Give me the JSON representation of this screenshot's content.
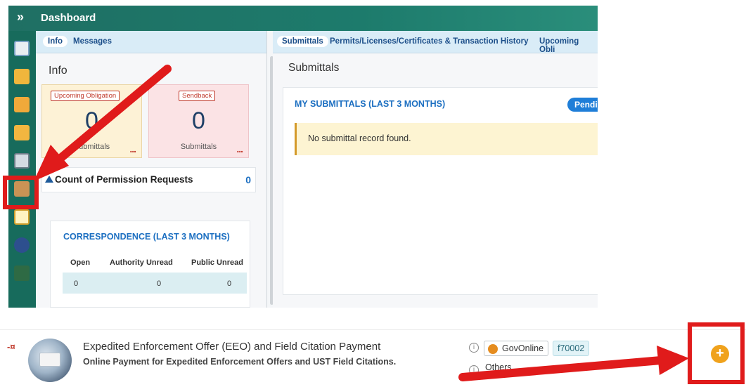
{
  "topbar": {
    "expand_glyph": "»",
    "title": "Dashboard"
  },
  "left_rail": {
    "icons": [
      "dashboard-icon",
      "folder-icon",
      "folder-icon",
      "folder-icon",
      "book-icon",
      "handshake-icon",
      "document-icon",
      "globe-icon",
      "building-icon"
    ]
  },
  "info_panel": {
    "tabs": [
      {
        "label": "Info",
        "active": true
      },
      {
        "label": "Messages",
        "active": false
      }
    ],
    "title": "Info",
    "upcoming": {
      "badge": "Upcoming Obligation",
      "count": "0",
      "label": "Submittals",
      "more": "..."
    },
    "sendback": {
      "badge": "Sendback",
      "count": "0",
      "label": "Submittals",
      "more": "..."
    },
    "permission": {
      "label": "Count of Permission Requests",
      "count": "0"
    },
    "correspondence": {
      "title": "CORRESPONDENCE (LAST 3 MONTHS)",
      "headers": [
        "Open",
        "Authority Unread",
        "Public Unread"
      ],
      "values": [
        "0",
        "0",
        "0"
      ]
    }
  },
  "submittals_panel": {
    "tabs": [
      {
        "label": "Submittals",
        "active": true
      },
      {
        "label": "Permits/Licenses/Certificates & Transaction History",
        "active": false
      },
      {
        "label": "Upcoming Obli",
        "active": false
      }
    ],
    "title": "Submittals",
    "my_submittals_title": "MY SUBMITTALS (LAST 3 MONTHS)",
    "pending_label": "Pending",
    "empty_message": "No submittal record found."
  },
  "list_item": {
    "pin_glyph": "-¤",
    "title": "Expedited Enforcement Offer (EEO) and Field Citation Payment",
    "subtitle": "Online Payment for Expedited Enforcement Offers and UST Field Citations.",
    "info_glyph": "i",
    "provider": "GovOnline",
    "code": "f70002",
    "others": "Others",
    "add_glyph": "+"
  },
  "colors": {
    "accent_red": "#e01b1b",
    "teal": "#1d7b6c",
    "orange": "#f0a21c",
    "blue_link": "#1c6fc1"
  }
}
